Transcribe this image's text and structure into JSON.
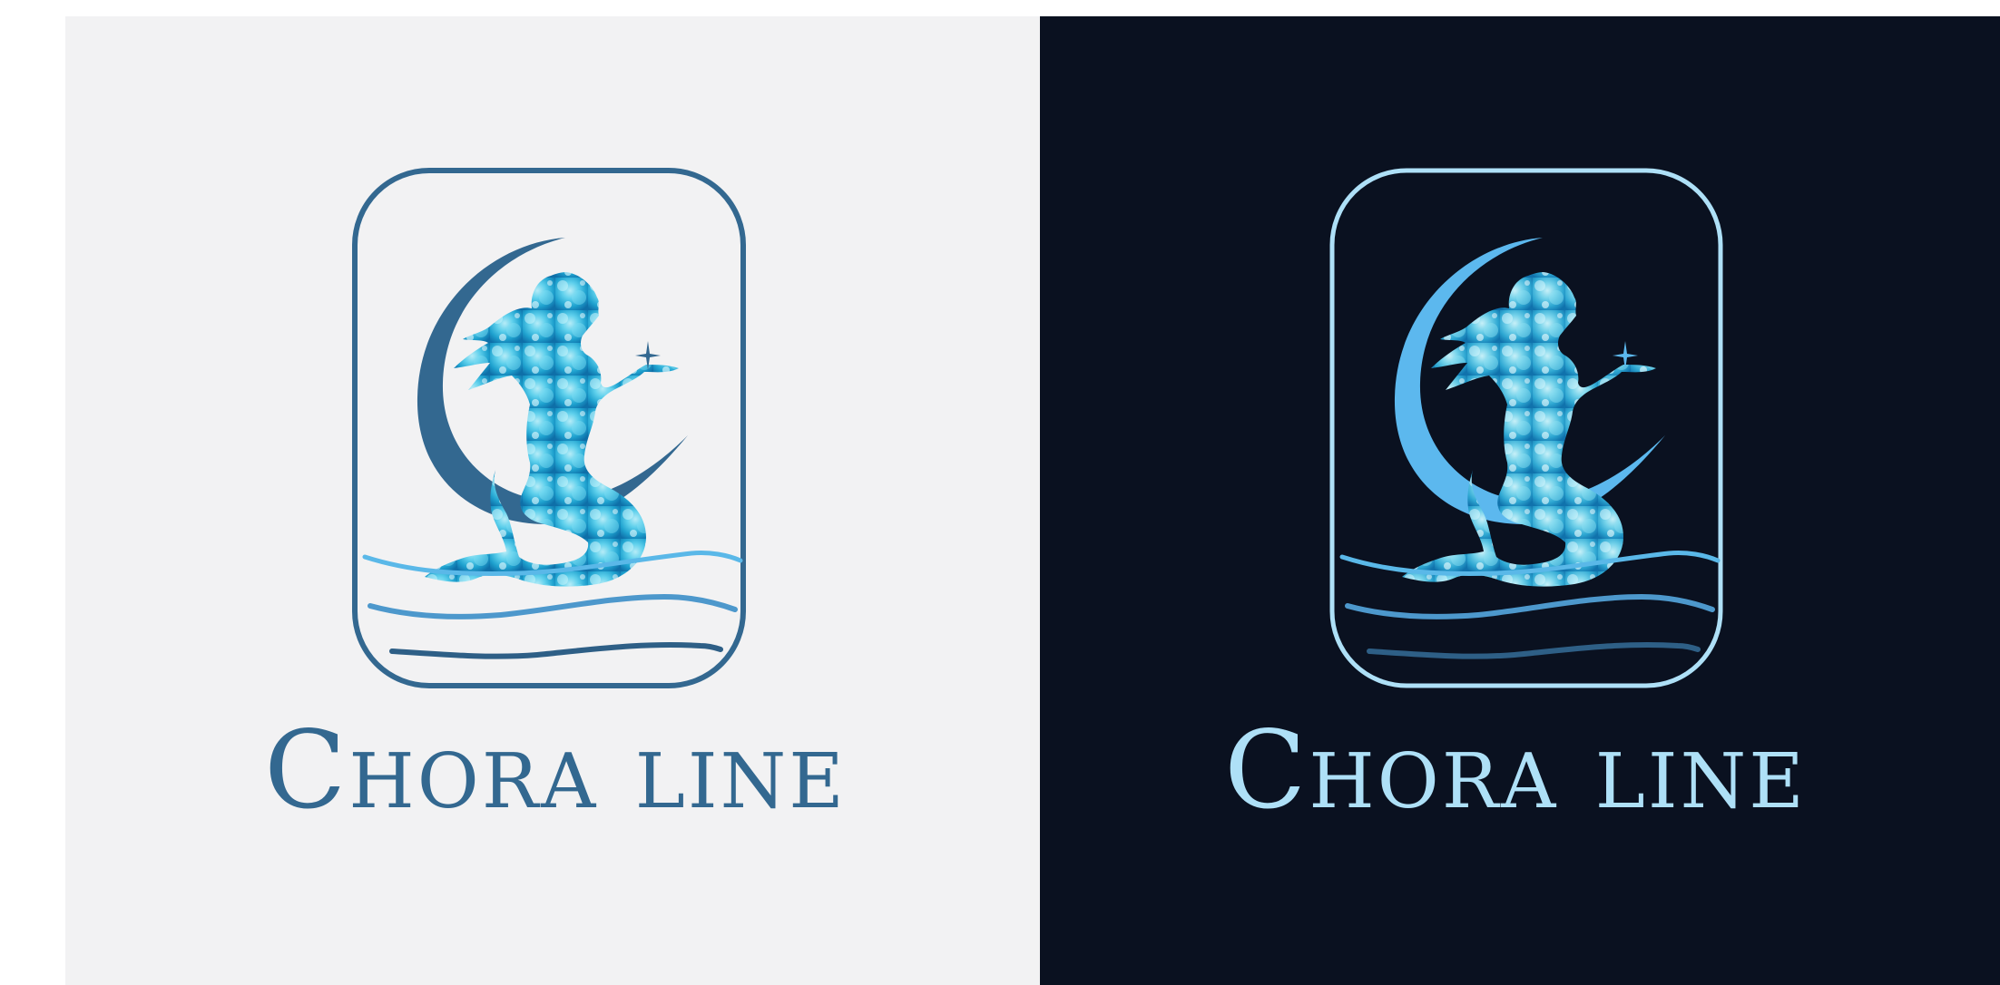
{
  "brand": {
    "name": "Chora line"
  },
  "variants": [
    {
      "id": "light",
      "background": "#f2f2f3",
      "frame_color": "#336890",
      "moon_color": "#336890",
      "wordmark_color": "#336890",
      "wave_colors": [
        "#5ab8e8",
        "#4d98cc",
        "#2e5f86"
      ]
    },
    {
      "id": "dark",
      "background": "#0a1120",
      "frame_color": "#aee0f7",
      "moon_color": "#5cb8ee",
      "wordmark_color": "#aee0f7",
      "wave_colors": [
        "#5ab8e8",
        "#4d98cc",
        "#2e5f86"
      ]
    }
  ],
  "figure": {
    "icon": "mermaid-on-crescent-moon-icon",
    "fill_colors": [
      "#0e6fa8",
      "#1fa2cf",
      "#5fd0ec",
      "#b6ecf7"
    ]
  },
  "star": {
    "icon": "sparkle-star-icon"
  }
}
